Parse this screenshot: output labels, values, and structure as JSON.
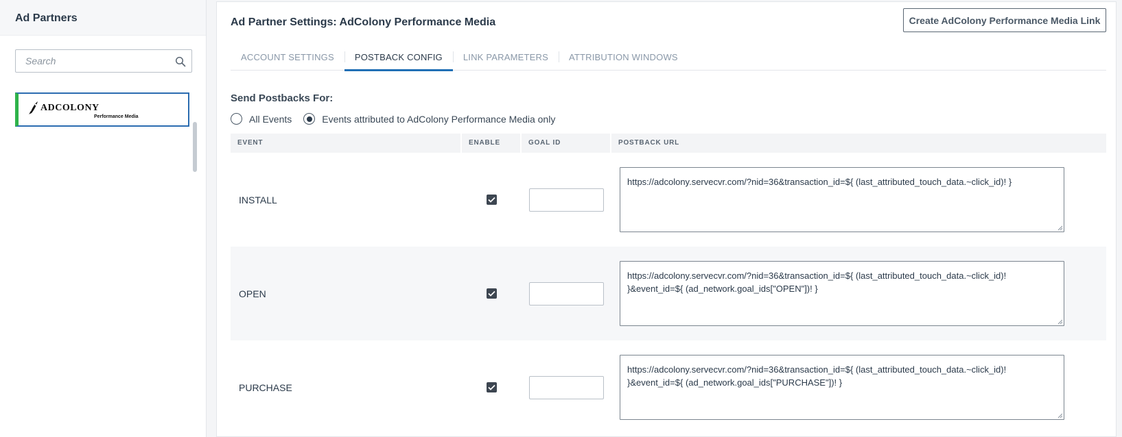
{
  "sidebar": {
    "title": "Ad Partners",
    "search_placeholder": "Search",
    "partner": {
      "logo_main": "ADCOLONY",
      "logo_sub": "Performance Media"
    }
  },
  "main": {
    "title": "Ad Partner Settings: AdColony Performance Media",
    "create_link_label": "Create AdColony Performance Media Link",
    "tabs": [
      {
        "label": "Account Settings"
      },
      {
        "label": "Postback Config"
      },
      {
        "label": "Link Parameters"
      },
      {
        "label": "Attribution Windows"
      }
    ],
    "active_tab": 1,
    "send_postbacks_label": "Send Postbacks For:",
    "radio_options": [
      {
        "label": "All Events",
        "checked": false
      },
      {
        "label": "Events attributed to AdColony Performance Media only",
        "checked": true
      }
    ],
    "table": {
      "headers": {
        "event": "Event",
        "enable": "Enable",
        "goal_id": "Goal ID",
        "postback_url": "Postback URL"
      },
      "rows": [
        {
          "event": "INSTALL",
          "enabled": true,
          "goal_id": "",
          "postback_url": "https://adcolony.servecvr.com/?nid=36&transaction_id=${ (last_attributed_touch_data.~click_id)! }"
        },
        {
          "event": "OPEN",
          "enabled": true,
          "goal_id": "",
          "postback_url": "https://adcolony.servecvr.com/?nid=36&transaction_id=${ (last_attributed_touch_data.~click_id)! }&event_id=${ (ad_network.goal_ids[\"OPEN\"])! }"
        },
        {
          "event": "PURCHASE",
          "enabled": true,
          "goal_id": "",
          "postback_url": "https://adcolony.servecvr.com/?nid=36&transaction_id=${ (last_attributed_touch_data.~click_id)! }&event_id=${ (ad_network.goal_ids[\"PURCHASE\"])! }"
        }
      ]
    }
  },
  "colors": {
    "accent": "#1f6fb5",
    "selected_border": "#2b6cb0",
    "selected_marker": "#2fb34a",
    "text": "#2b3a4a"
  }
}
